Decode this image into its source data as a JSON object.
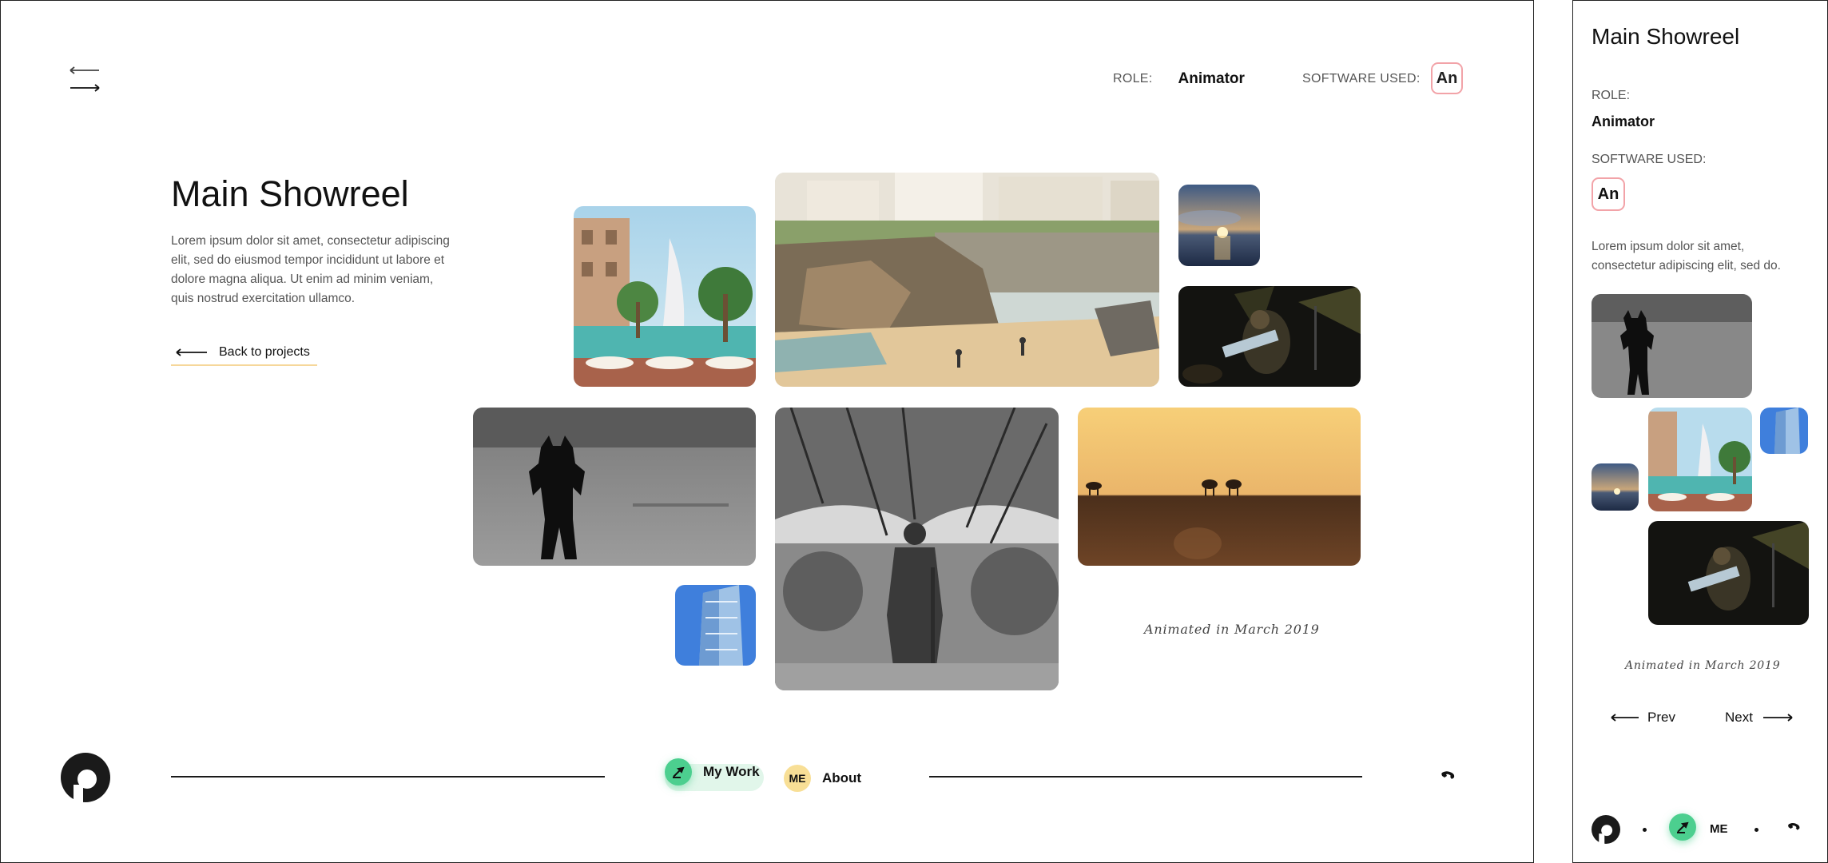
{
  "project": {
    "title": "Main Showreel",
    "description": "Lorem ipsum dolor sit amet, consectetur adipiscing elit, sed do eiusmod tempor incididunt ut labore et dolore magna aliqua. Ut enim ad minim veniam, quis nostrud exercitation ullamco.",
    "short_description": "Lorem ipsum dolor sit amet, consectetur adipiscing elit, sed do.",
    "role_label": "ROLE:",
    "role_value": "Animator",
    "software_label": "SOFTWARE USED:",
    "software_badge": "An",
    "caption": "Animated in March 2019",
    "back_label": "Back to projects"
  },
  "nav": {
    "my_work": "My Work",
    "about": "About",
    "about_badge": "ME"
  },
  "mobile_nav": {
    "prev": "Prev",
    "next": "Next",
    "me_badge": "ME"
  },
  "icons": {
    "menu": "menu-arrows-icon",
    "back": "arrow-left-icon",
    "work": "pen-nib-icon",
    "phone": "phone-icon",
    "logo": "brand-logo"
  },
  "colors": {
    "accent_green": "#4ccf8f",
    "accent_yellow": "#f8df96",
    "badge_border": "#f2a3a8",
    "underline": "#f6d79a"
  }
}
